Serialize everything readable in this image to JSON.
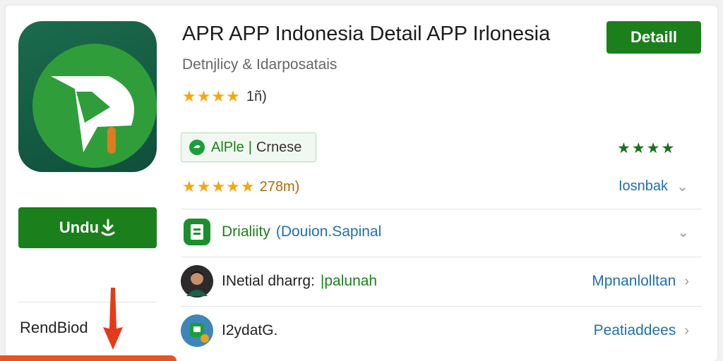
{
  "app": {
    "title": "APR APP Indonesia Detail APP Irlonesia",
    "subtitle": "Detnjlicy & Idarposatais",
    "detail_button": "Detaill",
    "rating_count": "1ñ)",
    "install_button": "Undu",
    "footer_label": "RendBiod"
  },
  "chip": {
    "left": "AlPle",
    "separator": "|",
    "right": "Crnese"
  },
  "green_stars": "★★★★",
  "rating2": {
    "count": "278m)",
    "link": "Iosnbak"
  },
  "rows": [
    {
      "label": "Drialiity",
      "sub": "(Douion.Sapinal",
      "right": ""
    },
    {
      "label": "INetial dharrg:",
      "sub": "|palunah",
      "right": "Mpnanlolltan"
    },
    {
      "label": "I2ydatG.",
      "sub": "",
      "right": "Peatiaddees"
    }
  ],
  "colors": {
    "brand_green": "#1b7f1b",
    "icon_bg": "#0f4f3b",
    "star": "#f3a712",
    "link_blue": "#1f6fb0",
    "accent_red": "#e8531f"
  }
}
